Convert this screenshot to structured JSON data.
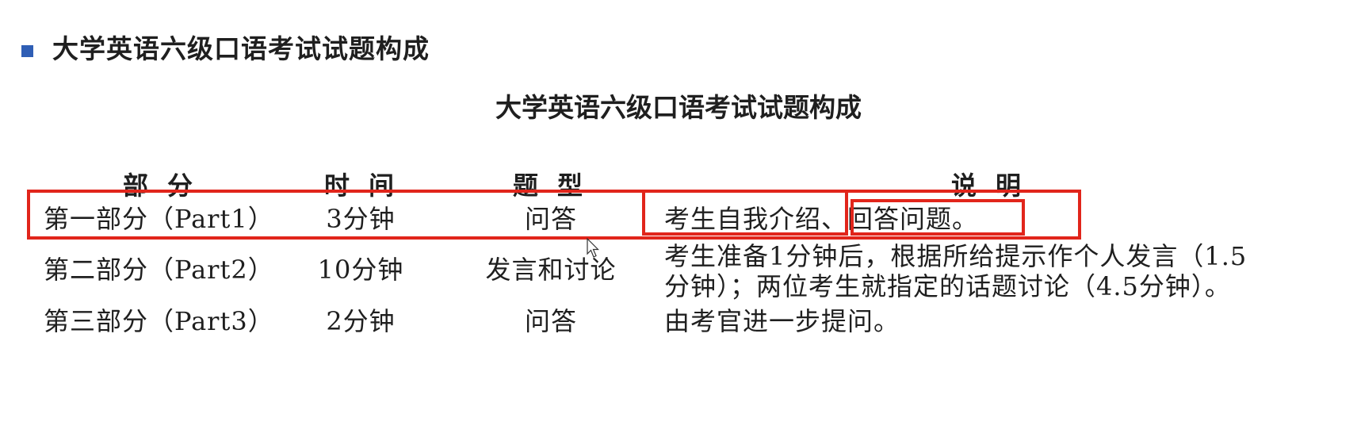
{
  "heading": {
    "text": "大学英语六级口语考试试题构成",
    "bullet_color": "#2f5eb5"
  },
  "table": {
    "title": "大学英语六级口语考试试题构成",
    "headers": {
      "part": "部分",
      "time": "时间",
      "type": "题型",
      "desc": "说明"
    },
    "rows": [
      {
        "part": "第一部分（Part1）",
        "time": "3分钟",
        "type": "问答",
        "desc": "考生自我介绍、回答问题。"
      },
      {
        "part": "第二部分（Part2）",
        "time": "10分钟",
        "type": "发言和讨论",
        "desc_lines": [
          "考生准备1分钟后，根据所给提示作个人发言（1.5",
          "分钟）；两位考生就指定的话题讨论（4.5分钟）。"
        ]
      },
      {
        "part": "第三部分（Part3）",
        "time": "2分钟",
        "type": "问答",
        "desc": "由考官进一步提问。"
      }
    ]
  },
  "highlight_color": "#e1251b"
}
